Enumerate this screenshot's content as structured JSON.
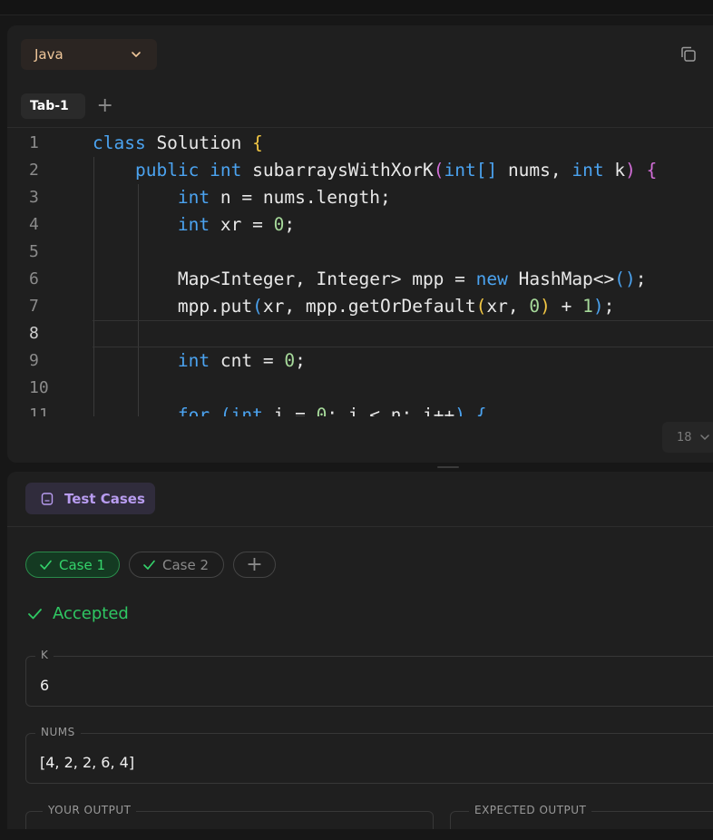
{
  "editor": {
    "language": "Java",
    "tabs": [
      {
        "label": "Tab-1"
      }
    ],
    "add_tab_symbol": "+",
    "zoom_value": "18",
    "active_line": 8,
    "line_numbers": [
      "1",
      "2",
      "3",
      "4",
      "5",
      "6",
      "7",
      "8",
      "9",
      "10",
      "11"
    ]
  },
  "test_cases": {
    "header_label": "Test Cases",
    "cases": [
      {
        "label": "Case 1",
        "status": "active"
      },
      {
        "label": "Case 2",
        "status": "inactive"
      }
    ],
    "add_case_symbol": "+",
    "result": "Accepted",
    "inputs": [
      {
        "label": "K",
        "value": "6"
      },
      {
        "label": "NUMS",
        "value": "[4, 2, 2, 6, 4]"
      }
    ],
    "your_output_label": "YOUR OUTPUT",
    "expected_output_label": "EXPECTED OUTPUT"
  },
  "colors": {
    "keyword": "#4ba3f0",
    "number": "#a6d99a",
    "bracket_1": "#f2c744",
    "bracket_2": "#d36ed9",
    "accepted": "#2fc763",
    "test_cases_accent": "#b89cf0",
    "language_text": "#f0c79a"
  }
}
